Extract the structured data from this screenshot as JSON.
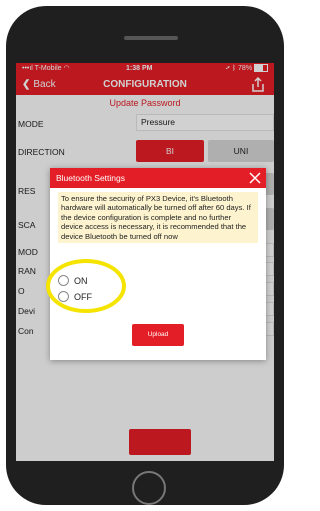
{
  "status_bar": {
    "carrier": "T-Mobile",
    "time": "1:38 PM",
    "battery": "78%"
  },
  "nav": {
    "back_label": "Back",
    "title": "CONFIGURATION",
    "share_icon": "share-upload-icon"
  },
  "update_password_label": "Update Password",
  "form": {
    "mode_label": "MODE",
    "mode_value": "Pressure",
    "direction_label": "DIRECTION",
    "direction_options": [
      "BI",
      "UNI"
    ],
    "direction_selected": "BI",
    "partial_labels": [
      "RES",
      "SCA",
      "MOD",
      "RAN",
      "O",
      "Devi",
      "Con"
    ]
  },
  "dialog": {
    "title": "Bluetooth Settings",
    "message": "To ensure the security of PX3 Device, it's Bluetooth hardware will automatically be turned off after 60 days. If the device configuration  is complete and no further device access is necessary, it is recommended that the device Bluetooth be turned off now",
    "options": [
      "ON",
      "OFF"
    ],
    "upload_label": "Upload"
  },
  "colors": {
    "accent": "#e41e26",
    "highlight": "#f5e400",
    "message_bg": "#fdf3cf"
  }
}
